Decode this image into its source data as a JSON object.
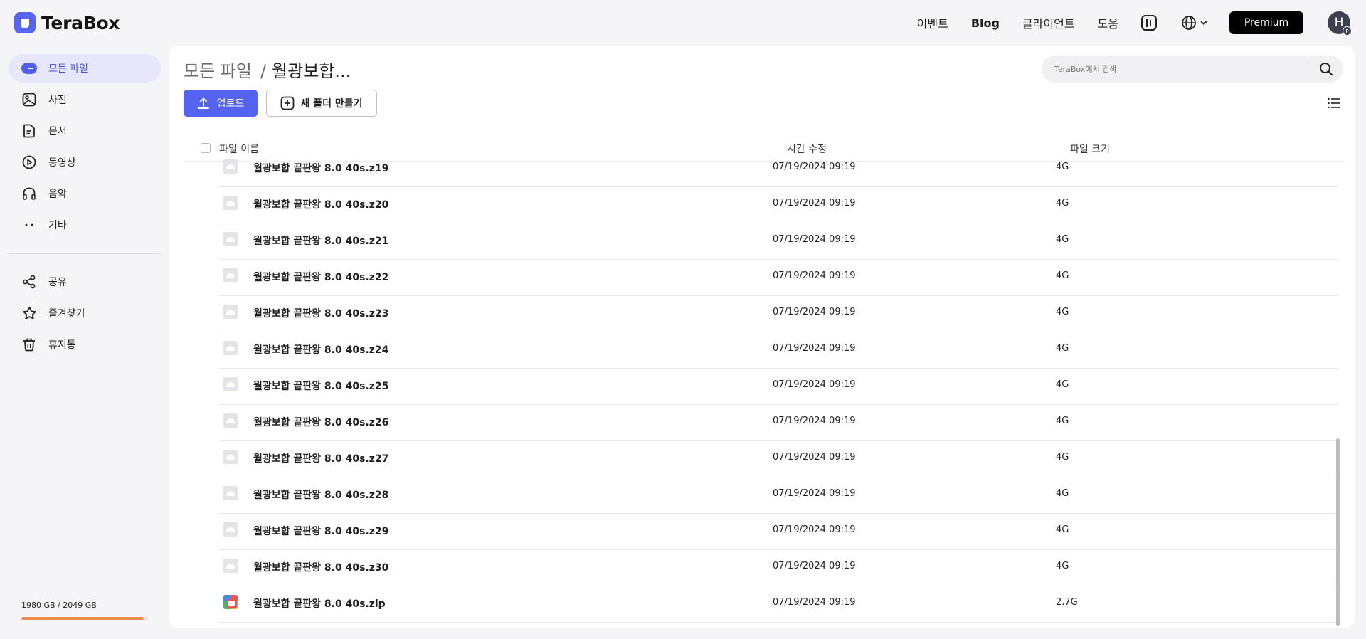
{
  "app": {
    "name": "TeraBox"
  },
  "topnav": {
    "event": "이벤트",
    "blog": "Blog",
    "client": "클라이언트",
    "help": "도움",
    "premium": "Premium",
    "avatar_letter": "H",
    "avatar_badge": "P"
  },
  "sidebar": {
    "items": [
      {
        "label": "모든 파일",
        "icon": "all-files-icon",
        "active": true
      },
      {
        "label": "사진",
        "icon": "photo-icon"
      },
      {
        "label": "문서",
        "icon": "document-icon"
      },
      {
        "label": "동영상",
        "icon": "video-icon"
      },
      {
        "label": "음악",
        "icon": "headphones-icon"
      },
      {
        "label": "기타",
        "icon": "more-icon"
      }
    ],
    "secondary": [
      {
        "label": "공유",
        "icon": "share-icon"
      },
      {
        "label": "즐겨찾기",
        "icon": "star-icon"
      },
      {
        "label": "휴지통",
        "icon": "trash-icon"
      }
    ],
    "storage": {
      "text": "1980 GB / 2049 GB",
      "used_fraction": 0.966,
      "bar_color": "#f08b4c"
    }
  },
  "main": {
    "breadcrumb": {
      "root": "모든 파일",
      "separator": "/",
      "current": "월광보합..."
    },
    "search": {
      "placeholder": "TeraBox에서 검색"
    },
    "buttons": {
      "upload": "업로드",
      "new_folder": "새 폴더 만들기"
    },
    "columns": {
      "name": "파일 이름",
      "modified": "시간 수정",
      "size": "파일 크기"
    },
    "files": [
      {
        "name": "월광보합 끝판왕 8.0 40s.z19",
        "modified": "07/19/2024 09:19",
        "size": "4G",
        "type": "file"
      },
      {
        "name": "월광보합 끝판왕 8.0 40s.z20",
        "modified": "07/19/2024 09:19",
        "size": "4G",
        "type": "file"
      },
      {
        "name": "월광보합 끝판왕 8.0 40s.z21",
        "modified": "07/19/2024 09:19",
        "size": "4G",
        "type": "file"
      },
      {
        "name": "월광보합 끝판왕 8.0 40s.z22",
        "modified": "07/19/2024 09:19",
        "size": "4G",
        "type": "file"
      },
      {
        "name": "월광보합 끝판왕 8.0 40s.z23",
        "modified": "07/19/2024 09:19",
        "size": "4G",
        "type": "file"
      },
      {
        "name": "월광보합 끝판왕 8.0 40s.z24",
        "modified": "07/19/2024 09:19",
        "size": "4G",
        "type": "file"
      },
      {
        "name": "월광보합 끝판왕 8.0 40s.z25",
        "modified": "07/19/2024 09:19",
        "size": "4G",
        "type": "file"
      },
      {
        "name": "월광보합 끝판왕 8.0 40s.z26",
        "modified": "07/19/2024 09:19",
        "size": "4G",
        "type": "file"
      },
      {
        "name": "월광보합 끝판왕 8.0 40s.z27",
        "modified": "07/19/2024 09:19",
        "size": "4G",
        "type": "file"
      },
      {
        "name": "월광보합 끝판왕 8.0 40s.z28",
        "modified": "07/19/2024 09:19",
        "size": "4G",
        "type": "file"
      },
      {
        "name": "월광보합 끝판왕 8.0 40s.z29",
        "modified": "07/19/2024 09:19",
        "size": "4G",
        "type": "file"
      },
      {
        "name": "월광보합 끝판왕 8.0 40s.z30",
        "modified": "07/19/2024 09:19",
        "size": "4G",
        "type": "file"
      },
      {
        "name": "월광보합 끝판왕 8.0 40s.zip",
        "modified": "07/19/2024 09:19",
        "size": "2.7G",
        "type": "zip"
      }
    ]
  },
  "colors": {
    "accent": "#5463f0",
    "active_nav_bg": "#e6e7fb",
    "premium_bg": "#000000"
  }
}
